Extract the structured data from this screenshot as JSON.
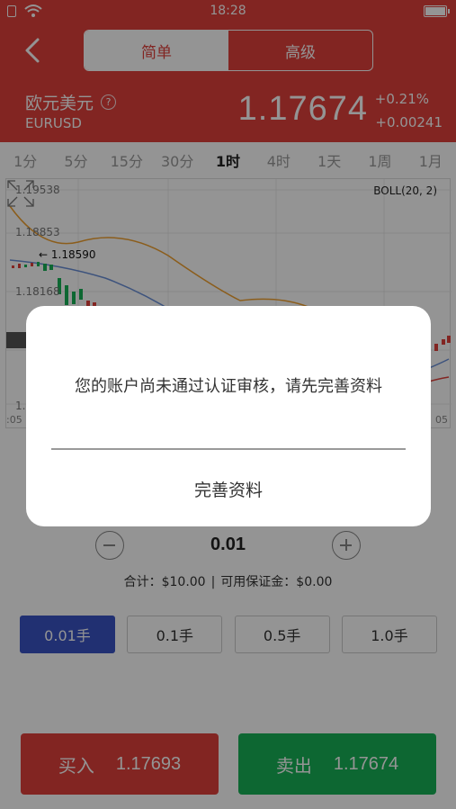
{
  "status_bar": {
    "time": "18:28"
  },
  "header": {
    "tabs": [
      {
        "label": "简单",
        "active": true
      },
      {
        "label": "高级",
        "active": false
      }
    ],
    "pair_name": "欧元美元",
    "help_glyph": "?",
    "pair_code": "EURUSD",
    "price": "1.17674",
    "change_percent": "+0.21%",
    "change_abs": "+0.00241"
  },
  "timeframes": [
    {
      "label": "1分",
      "active": false
    },
    {
      "label": "5分",
      "active": false
    },
    {
      "label": "15分",
      "active": false
    },
    {
      "label": "30分",
      "active": false
    },
    {
      "label": "1时",
      "active": true
    },
    {
      "label": "4时",
      "active": false
    },
    {
      "label": "1天",
      "active": false
    },
    {
      "label": "1周",
      "active": false
    },
    {
      "label": "1月",
      "active": false
    }
  ],
  "chart": {
    "indicator": "BOLL(20, 2)",
    "y_labels": [
      "1.19538",
      "1.18853",
      "1.18168"
    ],
    "partial_y_labels": [
      "1.",
      "1."
    ],
    "last_marker": "← 1.18590",
    "x_label_left": ":05",
    "x_label_right": "05"
  },
  "order": {
    "lot_value": "0.01",
    "summary_total": "合计：$10.00",
    "summary_margin": "可用保证金：$0.00",
    "separator": "|",
    "lot_options": [
      {
        "label": "0.01手",
        "active": true
      },
      {
        "label": "0.1手",
        "active": false
      },
      {
        "label": "0.5手",
        "active": false
      },
      {
        "label": "1.0手",
        "active": false
      }
    ],
    "buy_label": "买入",
    "buy_price": "1.17693",
    "sell_label": "卖出",
    "sell_price": "1.17674"
  },
  "modal": {
    "message": "您的账户尚未通过认证审核，请先完善资料",
    "action_label": "完善资料"
  },
  "colors": {
    "header_red": "#e0403c",
    "buy_red": "#e0403c",
    "sell_green": "#17b256",
    "lot_active_blue": "#3953c4"
  }
}
